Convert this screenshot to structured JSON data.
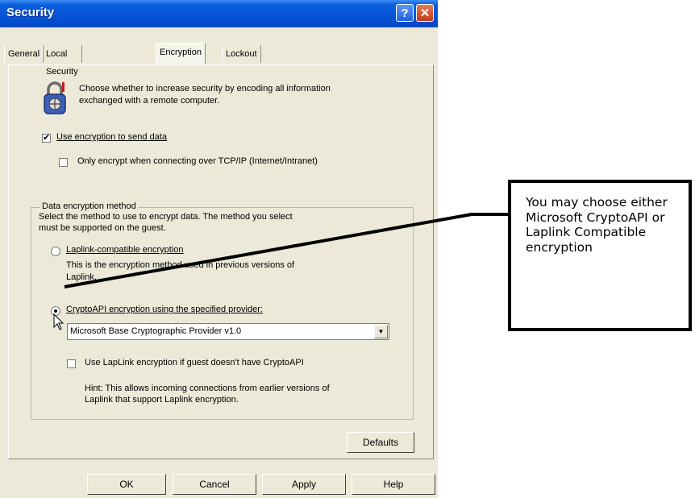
{
  "window": {
    "title": "Security",
    "help_glyph": "?",
    "close_glyph": "✕"
  },
  "tabs": [
    {
      "label": "General"
    },
    {
      "label": "Local Security"
    },
    {
      "label": "Encryption",
      "active": true
    },
    {
      "label": "Lockout"
    }
  ],
  "intro": {
    "icon": "lock-icon",
    "line1": "Choose whether to increase security by encoding all information",
    "line2": "exchanged with a remote computer."
  },
  "options": {
    "use_encryption": {
      "label": "Use encryption to send data",
      "checked": true
    },
    "only_tcp": {
      "label": "Only encrypt when connecting over TCP/IP (Internet/Intranet)",
      "checked": false
    }
  },
  "method_group": {
    "title": "Data encryption method",
    "desc_line1": "Select the method to use to encrypt data. The method you select",
    "desc_line2": "must be supported on the guest.",
    "laplink": {
      "label": "Laplink-compatible encryption",
      "note_line1": "This is the encryption method used in previous versions of",
      "note_line2": "Laplink.",
      "selected": false
    },
    "cryptoapi": {
      "label": "CryptoAPI encryption using the specified provider:",
      "selected": true,
      "provider": "Microsoft Base Cryptographic Provider v1.0"
    },
    "fallback": {
      "label": "Use LapLink encryption if guest doesn't have CryptoAPI",
      "checked": false
    },
    "hint_line1": "Hint: This allows incoming connections from earlier versions of",
    "hint_line2": "Laplink that support Laplink encryption."
  },
  "buttons": {
    "defaults": "Defaults",
    "ok": "OK",
    "cancel": "Cancel",
    "apply": "Apply",
    "help": "Help"
  },
  "callout": {
    "text": "You may choose either Microsoft CryptoAPI or Laplink Compatible encryption"
  },
  "check_glyph": "✔"
}
